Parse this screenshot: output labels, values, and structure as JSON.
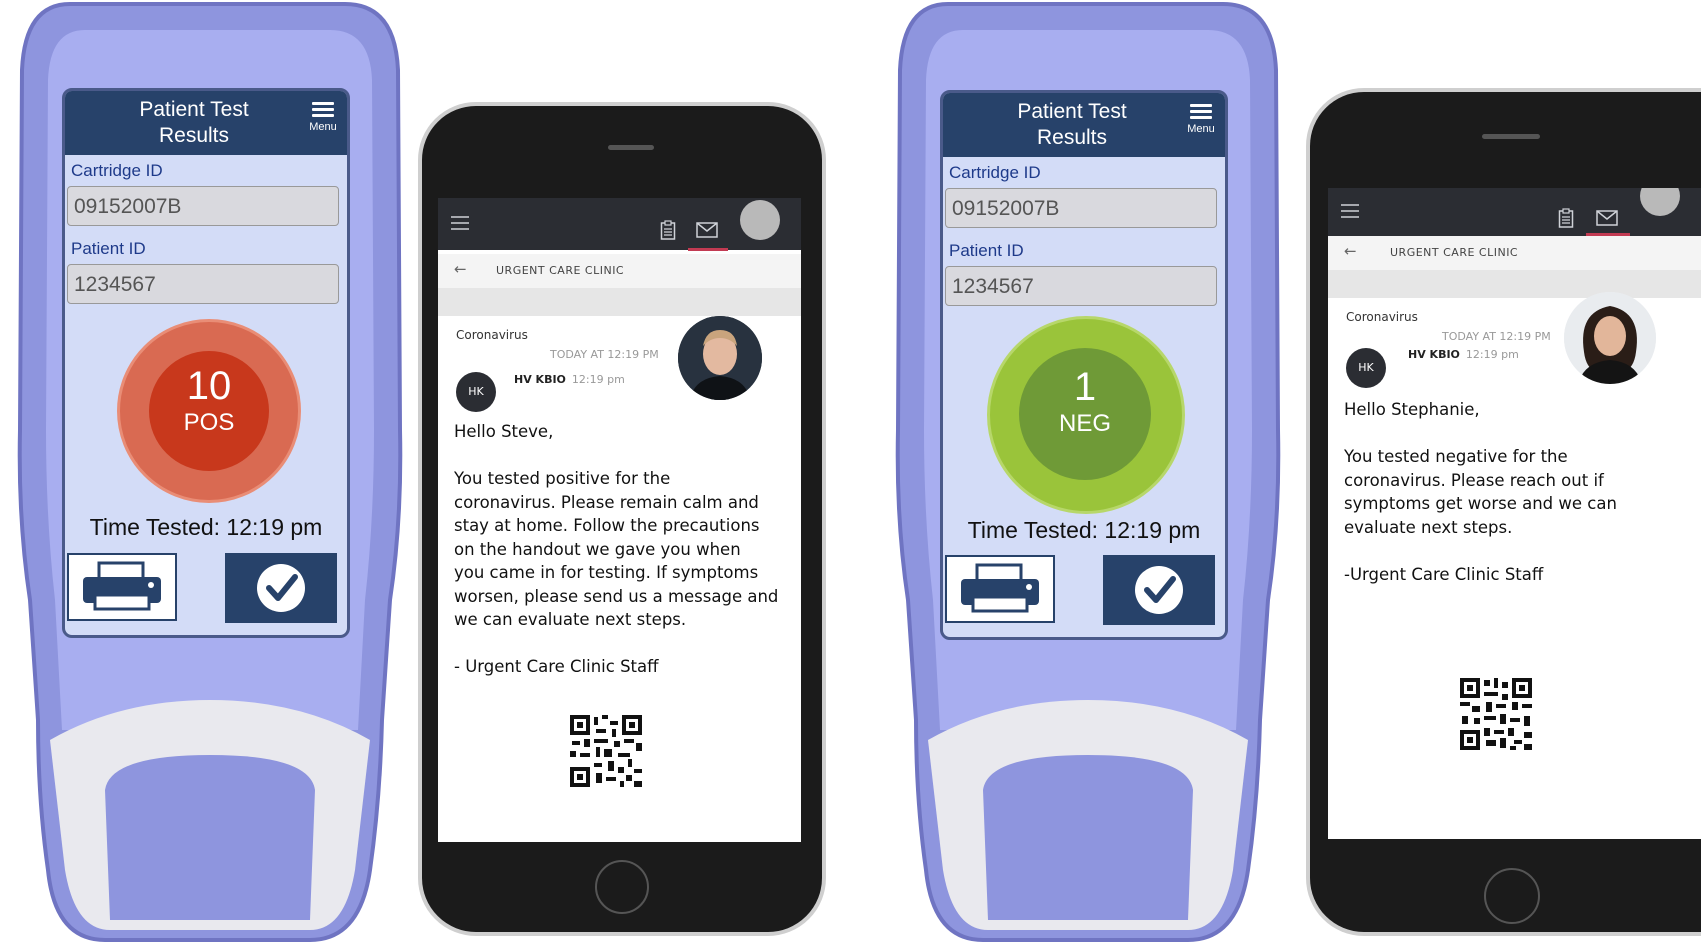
{
  "devices": [
    {
      "title": "Patient Test\nResults",
      "menu_label": "Menu",
      "cartridge_label": "Cartridge ID",
      "cartridge_value": "09152007B",
      "patient_label": "Patient ID",
      "patient_value": "1234567",
      "result_number": "10",
      "result_text": "POS",
      "time_tested": "Time Tested: 12:19 pm",
      "colors": {
        "outer": "#d96a52",
        "inner": "#c8381c"
      }
    },
    {
      "title": "Patient Test\nResults",
      "menu_label": "Menu",
      "cartridge_label": "Cartridge ID",
      "cartridge_value": "09152007B",
      "patient_label": "Patient ID",
      "patient_value": "1234567",
      "result_number": "1",
      "result_text": "NEG",
      "time_tested": "Time Tested: 12:19 pm",
      "colors": {
        "outer": "#9ac43a",
        "inner": "#6f9a37"
      }
    }
  ],
  "phones": [
    {
      "header": "URGENT CARE CLINIC",
      "subject": "Coronavirus",
      "date": "TODAY AT 12:19 PM",
      "initials": "HK",
      "sender": "HV KBIO",
      "sender_time": "12:19 pm",
      "body": "Hello Steve,\n\nYou tested positive for the\ncoronavirus. Please remain calm and\nstay at home. Follow the precautions\non the handout we gave you when\nyou came in for testing. If symptoms\nworsen, please send us a message and\nwe can evaluate next steps.\n\n- Urgent Care Clinic Staff"
    },
    {
      "header": "URGENT CARE CLINIC",
      "subject": "Coronavirus",
      "date": "TODAY AT 12:19 PM",
      "initials": "HK",
      "sender": "HV KBIO",
      "sender_time": "12:19 pm",
      "body": "Hello Stephanie,\n\nYou tested negative for the\ncoronavirus. Please reach out if\nsymptoms get worse and we can\nevaluate next steps.\n\n-Urgent Care Clinic Staff"
    }
  ],
  "icons": [
    "menu-icon",
    "printer-icon",
    "checkmark-icon",
    "hamburger-icon",
    "clipboard-icon",
    "mail-icon",
    "back-arrow-icon",
    "qr-code-icon"
  ]
}
